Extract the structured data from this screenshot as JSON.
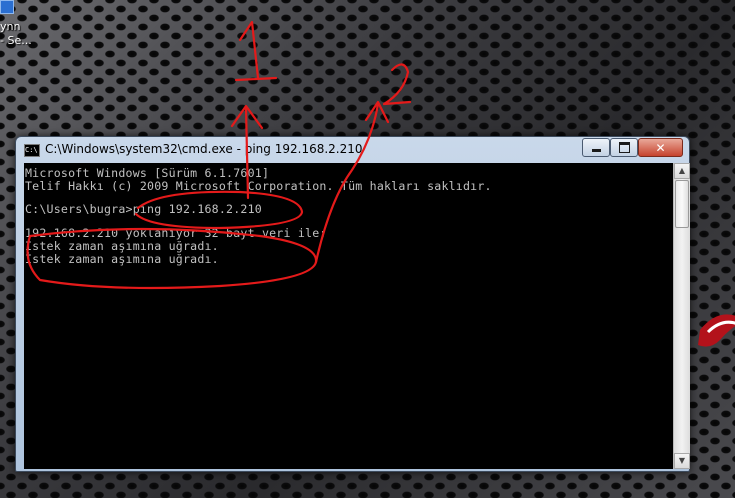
{
  "desktop": {
    "icon_label_line1": "ynn",
    "icon_label_line2": "- Se..."
  },
  "window": {
    "title": "C:\\Windows\\system32\\cmd.exe - ping  192.168.2.210",
    "app_icon_text": "C:\\",
    "controls": {
      "minimize": "minimize",
      "maximize": "maximize",
      "close": "✕"
    }
  },
  "console": {
    "lines": [
      "Microsoft Windows [Sürüm 6.1.7601]",
      "Telif Hakkı (c) 2009 Microsoft Corporation. Tüm hakları saklıdır.",
      "",
      "C:\\Users\\bugra>ping 192.168.2.210",
      "",
      "192.168.2.210 yoklanıyor 32 bayt veri ile:",
      "İstek zaman aşımına uğradı.",
      "İstek zaman aşımına uğradı."
    ]
  },
  "annotations": {
    "label_1": "1",
    "label_2": "2",
    "color": "#e41a1a"
  },
  "scrollbar": {
    "up_arrow": "▲",
    "down_arrow": "▼"
  }
}
